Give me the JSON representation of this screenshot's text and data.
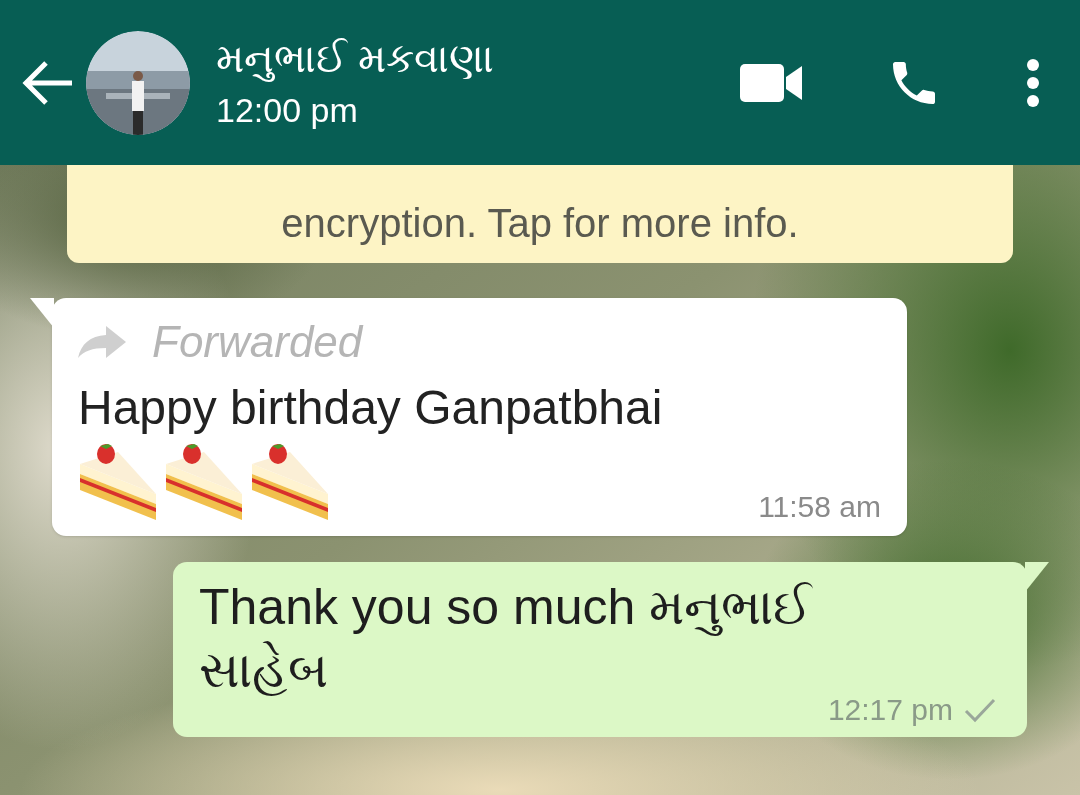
{
  "header": {
    "contact_name": "મનુભાઈ મકવાણા",
    "last_seen": "12:00 pm"
  },
  "encryption_notice": "encryption. Tap for more info.",
  "messages": [
    {
      "kind": "incoming",
      "forwarded": true,
      "forwarded_label": "Forwarded",
      "text": "Happy birthday Ganpatbhai",
      "time": "11:58 am"
    },
    {
      "kind": "outgoing",
      "text": "Thank you so much મનુભાઈ સાહેબ",
      "time": "12:17 pm",
      "read": false
    }
  ]
}
